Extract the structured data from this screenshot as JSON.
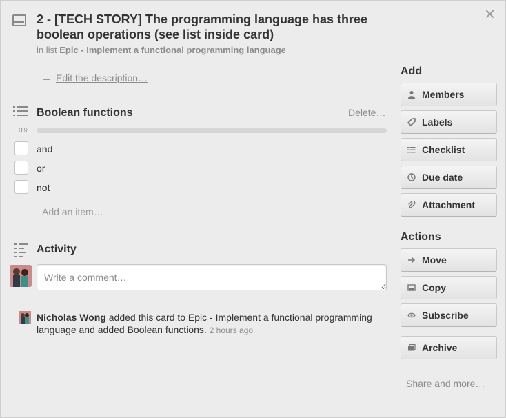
{
  "card": {
    "title": "2 - [TECH STORY] The programming language has three boolean operations (see list inside card)",
    "in_list_prefix": "in list",
    "list_name": "Epic - Implement a functional programming language"
  },
  "description": {
    "edit_label": "Edit the description…"
  },
  "checklist": {
    "title": "Boolean functions",
    "delete_label": "Delete…",
    "progress_label": "0%",
    "progress": 0,
    "items": [
      {
        "label": "and",
        "checked": false
      },
      {
        "label": "or",
        "checked": false
      },
      {
        "label": "not",
        "checked": false
      }
    ],
    "add_item_label": "Add an item…"
  },
  "activity": {
    "title": "Activity",
    "comment_placeholder": "Write a comment…",
    "log": {
      "user": "Nicholas Wong",
      "text": "added this card to Epic - Implement a functional programming language and added Boolean functions.",
      "time": "2 hours ago"
    }
  },
  "sidebar": {
    "add_title": "Add",
    "add_buttons": [
      {
        "label": "Members",
        "icon": "person-icon"
      },
      {
        "label": "Labels",
        "icon": "tag-icon"
      },
      {
        "label": "Checklist",
        "icon": "checklist-icon"
      },
      {
        "label": "Due date",
        "icon": "clock-icon"
      },
      {
        "label": "Attachment",
        "icon": "paperclip-icon"
      }
    ],
    "actions_title": "Actions",
    "action_buttons": [
      {
        "label": "Move",
        "icon": "arrow-right-icon"
      },
      {
        "label": "Copy",
        "icon": "card-icon"
      },
      {
        "label": "Subscribe",
        "icon": "eye-icon"
      },
      {
        "label": "Archive",
        "icon": "archive-icon"
      }
    ],
    "share_label": "Share and more…"
  },
  "close_glyph": "×"
}
